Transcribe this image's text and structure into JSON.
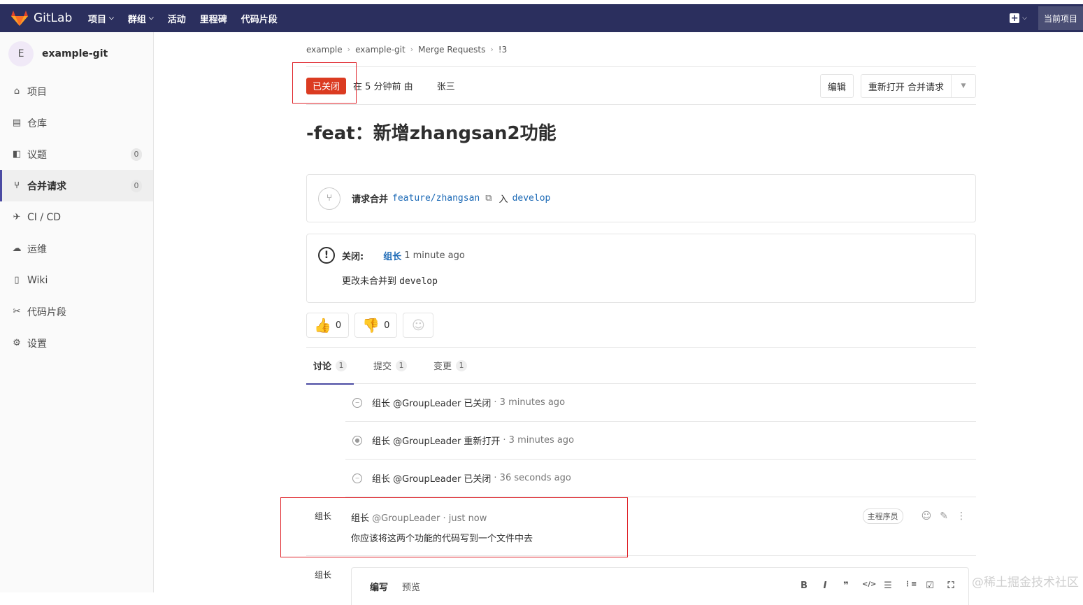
{
  "topbar": {
    "brand": "GitLab",
    "nav": [
      "项目",
      "群组",
      "活动",
      "里程碑",
      "代码片段"
    ],
    "current_project": "当前项目"
  },
  "sidebar": {
    "avatar_letter": "E",
    "project_name": "example-git",
    "items": [
      {
        "label": "项目",
        "icon": "home-icon"
      },
      {
        "label": "仓库",
        "icon": "file-icon"
      },
      {
        "label": "议题",
        "icon": "issues-icon",
        "count": "0"
      },
      {
        "label": "合并请求",
        "icon": "merge-request-icon",
        "count": "0"
      },
      {
        "label": "CI / CD",
        "icon": "rocket-icon"
      },
      {
        "label": "运维",
        "icon": "cloud-icon"
      },
      {
        "label": "Wiki",
        "icon": "book-icon"
      },
      {
        "label": "代码片段",
        "icon": "scissors-icon"
      },
      {
        "label": "设置",
        "icon": "gear-icon"
      }
    ]
  },
  "breadcrumb": [
    "example",
    "example-git",
    "Merge Requests",
    "!3"
  ],
  "detail": {
    "status": "已关闭",
    "opened_text": "在 5 分钟前 由",
    "author": "张三",
    "edit_button": "编辑",
    "reopen_button": "重新打开 合并请求"
  },
  "title": "-feat：新增zhangsan2功能",
  "merge_info": {
    "prefix": "请求合并",
    "source": "feature/zhangsan",
    "into": "入",
    "target": "develop"
  },
  "closed_info": {
    "label": "关闭:",
    "by": "组长",
    "time": "1 minute ago",
    "message": "更改未合并到",
    "branch": "develop"
  },
  "awards": {
    "thumbs_up": "0",
    "thumbs_down": "0"
  },
  "tabs": [
    {
      "label": "讨论",
      "count": "1"
    },
    {
      "label": "提交",
      "count": "1"
    },
    {
      "label": "变更",
      "count": "1"
    }
  ],
  "system_notes": [
    {
      "who": "组长 @GroupLeader 已关闭",
      "ago": "· 3 minutes ago",
      "icon": "closed-circle-icon"
    },
    {
      "who": "组长 @GroupLeader 重新打开",
      "ago": "· 3 minutes ago",
      "icon": "reopen-circle-icon"
    },
    {
      "who": "组长 @GroupLeader 已关闭",
      "ago": "· 36 seconds ago",
      "icon": "closed-circle-icon"
    }
  ],
  "comment": {
    "avatar_alt": "组长",
    "author": "组长",
    "handle": "@GroupLeader",
    "time": "· just now",
    "role": "主程序员",
    "body": "你应该将这两个功能的代码写到一个文件中去"
  },
  "editor": {
    "avatar_alt": "组长",
    "write_tab": "编写",
    "preview_tab": "预览",
    "tools": [
      "B",
      "I",
      "❞",
      "</>",
      "☰",
      "⋮≡",
      "☑",
      "⛶"
    ]
  },
  "watermark": "@稀土掘金技术社区",
  "colors": {
    "topbar": "#2b2f5e",
    "closed_badge": "#db3b21",
    "link": "#1b69b6",
    "highlight": "#e0262c"
  }
}
